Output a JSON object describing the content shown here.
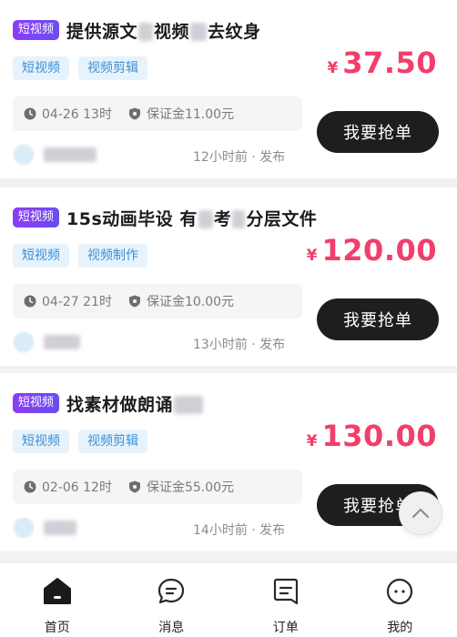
{
  "cards": [
    {
      "badge": "短视频",
      "title_parts": [
        "提供源文",
        "视频",
        "去纹身"
      ],
      "tags": [
        "短视频",
        "视频剪辑"
      ],
      "currency": "¥",
      "price": "37.50",
      "deadline": "04-26 13时",
      "deposit": "保证金11.00元",
      "action": "我要抢单",
      "posted": "12小时前 · 发布"
    },
    {
      "badge": "短视频",
      "title_parts": [
        "15s动画毕设 有",
        "考",
        "分层文件"
      ],
      "tags": [
        "短视频",
        "视频制作"
      ],
      "currency": "¥",
      "price": "120.00",
      "deadline": "04-27 21时",
      "deposit": "保证金10.00元",
      "action": "我要抢单",
      "posted": "13小时前 · 发布"
    },
    {
      "badge": "短视频",
      "title_parts": [
        "找素材做朗诵",
        "",
        ""
      ],
      "tags": [
        "短视频",
        "视频剪辑"
      ],
      "currency": "¥",
      "price": "130.00",
      "deadline": "02-06 12时",
      "deposit": "保证金55.00元",
      "action": "我要抢单",
      "posted": "14小时前 · 发布"
    }
  ],
  "tabbar": {
    "home": "首页",
    "messages": "消息",
    "orders": "订单",
    "mine": "我的"
  },
  "icons": {
    "clock": "clock-icon",
    "shield": "shield-icon",
    "scroll_top": "chevron-up-icon"
  }
}
